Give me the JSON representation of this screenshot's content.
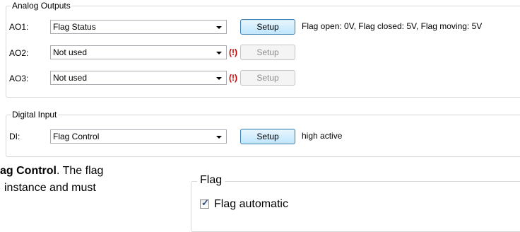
{
  "analog_outputs": {
    "title": "Analog Outputs",
    "rows": [
      {
        "label": "AO1:",
        "selection": "Flag Status",
        "warning": "",
        "button": "Setup",
        "enabled": true,
        "description": "Flag open: 0V, Flag closed: 5V, Flag moving: 5V"
      },
      {
        "label": "AO2:",
        "selection": "Not used",
        "warning": "(!)",
        "button": "Setup",
        "enabled": false,
        "description": ""
      },
      {
        "label": "AO3:",
        "selection": "Not used",
        "warning": "(!)",
        "button": "Setup",
        "enabled": false,
        "description": ""
      }
    ]
  },
  "digital_input": {
    "title": "Digital Input",
    "row": {
      "label": "DI:",
      "selection": "Flag Control",
      "button": "Setup",
      "enabled": true,
      "description": "high active"
    }
  },
  "body_text": {
    "line1_bold": "ag Control",
    "line1_rest": ". The flag",
    "line2": "instance and must"
  },
  "flag_group": {
    "title": "Flag",
    "checkbox_label": "Flag automatic",
    "checked": true
  },
  "colors": {
    "warning": "#cc0000",
    "button_border": "#3c7fb1"
  }
}
